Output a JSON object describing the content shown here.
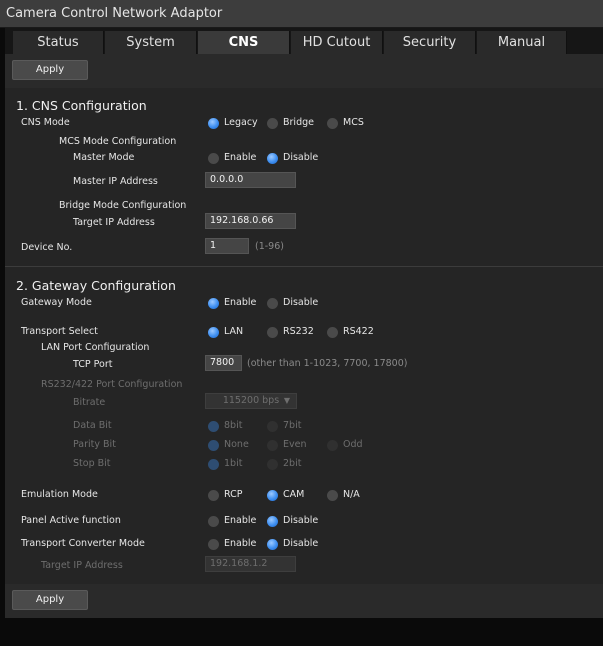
{
  "app": {
    "title": "Camera Control Network Adaptor"
  },
  "tabs": [
    "Status",
    "System",
    "CNS",
    "HD Cutout",
    "Security",
    "Manual"
  ],
  "buttons": {
    "apply_top": "Apply",
    "apply_bottom": "Apply"
  },
  "cns": {
    "title": "1. CNS Configuration",
    "mode_label": "CNS Mode",
    "mode_options": [
      "Legacy",
      "Bridge",
      "MCS"
    ],
    "mode_selected": "Legacy",
    "mcs_heading": "MCS Mode Configuration",
    "master_mode_label": "Master Mode",
    "master_mode_options": [
      "Enable",
      "Disable"
    ],
    "master_mode_selected": "Disable",
    "master_ip_label": "Master IP Address",
    "master_ip_value": "0.0.0.0",
    "bridge_heading": "Bridge Mode Configuration",
    "target_ip_label": "Target IP Address",
    "target_ip_value": "192.168.0.66",
    "device_no_label": "Device No.",
    "device_no_value": "1",
    "device_no_hint": "(1-96)"
  },
  "gateway": {
    "title": "2. Gateway Configuration",
    "mode_label": "Gateway Mode",
    "mode_options": [
      "Enable",
      "Disable"
    ],
    "mode_selected": "Enable",
    "transport_label": "Transport Select",
    "transport_options": [
      "LAN",
      "RS232",
      "RS422"
    ],
    "transport_selected": "LAN",
    "lan_heading": "LAN Port Configuration",
    "tcp_port_label": "TCP Port",
    "tcp_port_value": "7800",
    "tcp_port_hint": "(other than 1-1023, 7700, 17800)",
    "serial_heading": "RS232/422 Port Configuration",
    "bitrate_label": "Bitrate",
    "bitrate_value": "115200 bps",
    "databit_label": "Data Bit",
    "databit_options": [
      "8bit",
      "7bit"
    ],
    "databit_selected": "8bit",
    "parity_label": "Parity Bit",
    "parity_options": [
      "None",
      "Even",
      "Odd"
    ],
    "parity_selected": "None",
    "stopbit_label": "Stop Bit",
    "stopbit_options": [
      "1bit",
      "2bit"
    ],
    "stopbit_selected": "1bit",
    "emulation_label": "Emulation Mode",
    "emulation_options": [
      "RCP",
      "CAM",
      "N/A"
    ],
    "emulation_selected": "CAM",
    "panel_active_label": "Panel Active function",
    "panel_active_options": [
      "Enable",
      "Disable"
    ],
    "panel_active_selected": "Disable",
    "converter_label": "Transport Converter Mode",
    "converter_options": [
      "Enable",
      "Disable"
    ],
    "converter_selected": "Disable",
    "converter_target_label": "Target IP Address",
    "converter_target_value": "192.168.1.2"
  }
}
